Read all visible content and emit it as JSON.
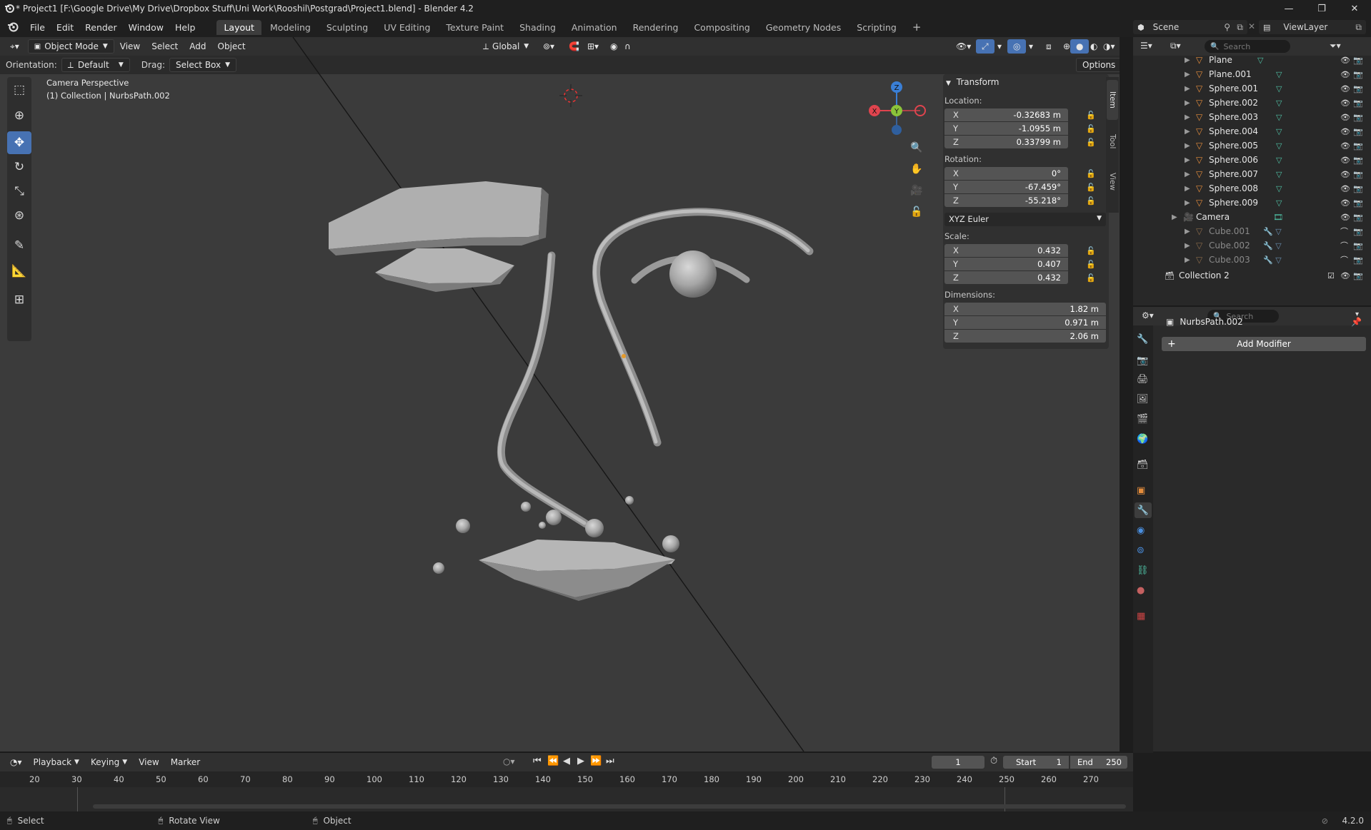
{
  "window": {
    "title": "* Project1 [F:\\Google Drive\\My Drive\\Dropbox Stuff\\Uni Work\\Rooshil\\Postgrad\\Project1.blend] - Blender 4.2"
  },
  "menu": [
    "File",
    "Edit",
    "Render",
    "Window",
    "Help"
  ],
  "workspaces": [
    "Layout",
    "Modeling",
    "Sculpting",
    "UV Editing",
    "Texture Paint",
    "Shading",
    "Animation",
    "Rendering",
    "Compositing",
    "Geometry Nodes",
    "Scripting"
  ],
  "active_workspace": "Layout",
  "scene": {
    "name": "Scene",
    "view_layer": "ViewLayer"
  },
  "viewport_header": {
    "mode": "Object Mode",
    "menus": [
      "View",
      "Select",
      "Add",
      "Object"
    ],
    "transform_orientation": "Global",
    "orientation_label": "Orientation:",
    "orientation_value": "Default",
    "drag_label": "Drag:",
    "drag_value": "Select Box",
    "options_label": "Options"
  },
  "viewport_info": {
    "line1": "Camera Perspective",
    "line2": "(1) Collection | NurbsPath.002"
  },
  "gizmo": {
    "x": "X",
    "y": "Y",
    "z": "Z"
  },
  "npanel": {
    "section": "Transform",
    "location_label": "Location:",
    "location": [
      {
        "axis": "X",
        "value": "-0.32683 m"
      },
      {
        "axis": "Y",
        "value": "-1.0955 m"
      },
      {
        "axis": "Z",
        "value": "0.33799 m"
      }
    ],
    "rotation_label": "Rotation:",
    "rotation": [
      {
        "axis": "X",
        "value": "0°"
      },
      {
        "axis": "Y",
        "value": "-67.459°"
      },
      {
        "axis": "Z",
        "value": "-55.218°"
      }
    ],
    "rotation_mode": "XYZ Euler",
    "scale_label": "Scale:",
    "scale": [
      {
        "axis": "X",
        "value": "0.432"
      },
      {
        "axis": "Y",
        "value": "0.407"
      },
      {
        "axis": "Z",
        "value": "0.432"
      }
    ],
    "dimensions_label": "Dimensions:",
    "dimensions": [
      {
        "axis": "X",
        "value": "1.82 m"
      },
      {
        "axis": "Y",
        "value": "0.971 m"
      },
      {
        "axis": "Z",
        "value": "2.06 m"
      }
    ],
    "tabs": [
      "Item",
      "Tool",
      "View"
    ]
  },
  "outliner": {
    "search_placeholder": "Search",
    "rows": [
      {
        "name": "Plane",
        "type": "mesh",
        "dim": false
      },
      {
        "name": "Plane.001",
        "type": "mesh",
        "dim": false
      },
      {
        "name": "Sphere.001",
        "type": "mesh",
        "dim": false
      },
      {
        "name": "Sphere.002",
        "type": "mesh",
        "dim": false
      },
      {
        "name": "Sphere.003",
        "type": "mesh",
        "dim": false
      },
      {
        "name": "Sphere.004",
        "type": "mesh",
        "dim": false
      },
      {
        "name": "Sphere.005",
        "type": "mesh",
        "dim": false
      },
      {
        "name": "Sphere.006",
        "type": "mesh",
        "dim": false
      },
      {
        "name": "Sphere.007",
        "type": "mesh",
        "dim": false
      },
      {
        "name": "Sphere.008",
        "type": "mesh",
        "dim": false
      },
      {
        "name": "Sphere.009",
        "type": "mesh",
        "dim": false
      },
      {
        "name": "Camera",
        "type": "camera",
        "dim": false
      },
      {
        "name": "Cube.001",
        "type": "mesh",
        "dim": true
      },
      {
        "name": "Cube.002",
        "type": "mesh",
        "dim": true
      },
      {
        "name": "Cube.003",
        "type": "mesh",
        "dim": true
      }
    ],
    "collection2": "Collection 2"
  },
  "properties": {
    "search_placeholder": "Search",
    "object_name": "NurbsPath.002",
    "add_modifier": "Add Modifier"
  },
  "timeline": {
    "menus": [
      "Playback",
      "Keying",
      "View",
      "Marker"
    ],
    "current_frame": "1",
    "start_label": "Start",
    "start_value": "1",
    "end_label": "End",
    "end_value": "250",
    "ruler": [
      "20",
      "30",
      "40",
      "50",
      "60",
      "70",
      "80",
      "90",
      "100",
      "110",
      "120",
      "130",
      "140",
      "150",
      "160",
      "170",
      "180",
      "190",
      "200",
      "210",
      "220",
      "230",
      "240",
      "250",
      "260",
      "270"
    ]
  },
  "statusbar": {
    "select": "Select",
    "rotate": "Rotate View",
    "object": "Object",
    "version": "4.2.0"
  },
  "colors": {
    "accent": "#4772b3",
    "axis_x": "#e0444e",
    "axis_y": "#8bc43a",
    "axis_z": "#3a7fd6",
    "mesh_icon": "#e58d3c",
    "mesh_data": "#4fc1a5"
  }
}
